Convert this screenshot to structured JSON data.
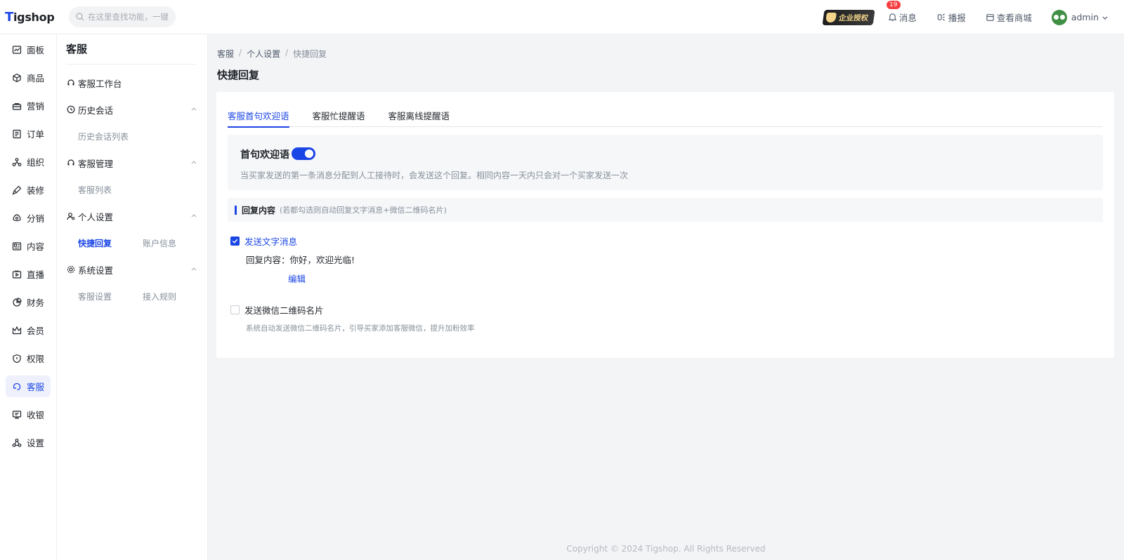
{
  "brand": {
    "logo_t": "T",
    "logo_rest": "igshop"
  },
  "search": {
    "placeholder": "在这里查找功能，一键直达"
  },
  "topbar": {
    "auth_badge": "企业授权",
    "messages_label": "消息",
    "messages_count": "19",
    "broadcast_label": "播报",
    "store_label": "查看商城",
    "user_name": "admin"
  },
  "rail": {
    "items": [
      {
        "label": "面板",
        "icon": "chart-line-icon"
      },
      {
        "label": "商品",
        "icon": "cube-icon"
      },
      {
        "label": "营销",
        "icon": "gift-icon"
      },
      {
        "label": "订单",
        "icon": "order-icon"
      },
      {
        "label": "组织",
        "icon": "org-icon"
      },
      {
        "label": "装修",
        "icon": "brush-icon"
      },
      {
        "label": "分销",
        "icon": "share-icon"
      },
      {
        "label": "内容",
        "icon": "content-icon"
      },
      {
        "label": "直播",
        "icon": "live-icon"
      },
      {
        "label": "财务",
        "icon": "pie-icon"
      },
      {
        "label": "会员",
        "icon": "crown-icon"
      },
      {
        "label": "权限",
        "icon": "shield-icon"
      },
      {
        "label": "客服",
        "icon": "headset-icon"
      },
      {
        "label": "收银",
        "icon": "cashier-icon"
      },
      {
        "label": "设置",
        "icon": "settings-icon"
      }
    ]
  },
  "submenu": {
    "title": "客服",
    "workbench": "客服工作台",
    "history": "历史会话",
    "history_list": "历史会话列表",
    "manage": "客服管理",
    "agent_list": "客服列表",
    "personal": "个人设置",
    "quick_reply": "快捷回复",
    "account_info": "账户信息",
    "system": "系统设置",
    "service_settings": "客服设置",
    "access_rules": "接入规则"
  },
  "breadcrumb": {
    "level1": "客服",
    "level2": "个人设置",
    "level3": "快捷回复",
    "sep": "/"
  },
  "page": {
    "title": "快捷回复"
  },
  "tabs": [
    "客服首句欢迎语",
    "客服忙提醒语",
    "客服离线提醒语"
  ],
  "welcome": {
    "label": "首句欢迎语",
    "enabled": true,
    "description": "当买家发送的第一条消息分配到人工接待时，会发送这个回复。相同内容一天内只会对一个买家发送一次"
  },
  "reply_section": {
    "title": "回复内容",
    "hint": "(若都勾选则自动回复文字消息+微信二维码名片)",
    "send_text_label": "发送文字消息",
    "send_text_checked": true,
    "reply_content_label": "回复内容：",
    "reply_content_value": "你好，欢迎光临!",
    "edit_label": "编辑",
    "send_wechat_label": "发送微信二维码名片",
    "send_wechat_checked": false,
    "wechat_desc": "系统自动发送微信二维码名片，引导买家添加客服微信，提升加粉效率"
  },
  "footer": {
    "copyright": "Copyright © 2024 Tigshop. All Rights Reserved"
  },
  "colors": {
    "accent": "#1b46e6",
    "danger": "#f53f3f"
  }
}
